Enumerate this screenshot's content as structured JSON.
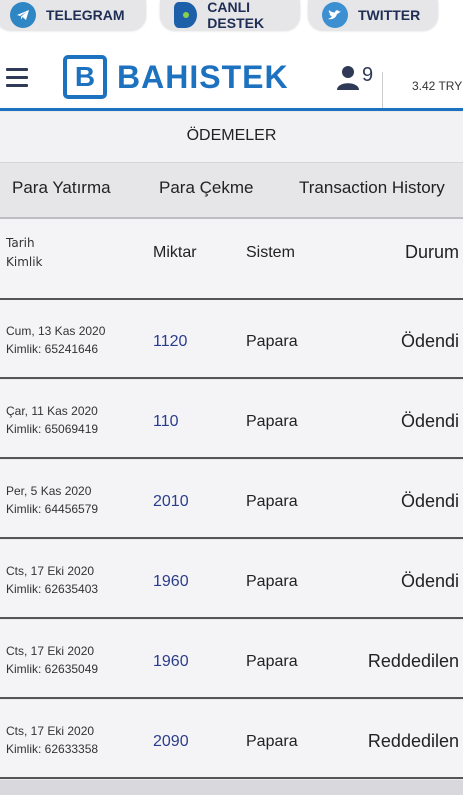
{
  "social": {
    "telegram": "TELEGRAM",
    "live_support": "CANLI DESTEK",
    "twitter": "TWITTER"
  },
  "header": {
    "logo_letter": "B",
    "logo_text": "BAHISTEK",
    "user_count": "9",
    "balance": "3.42 TRY"
  },
  "page_title": "ÖDEMELER",
  "tabs": [
    "Para Yatırma",
    "Para Çekme",
    "Transaction History"
  ],
  "table": {
    "headers": {
      "date": "Tarih",
      "id": "Kimlik",
      "amount": "Miktar",
      "system": "Sistem",
      "status": "Durum"
    },
    "rows": [
      {
        "date": "Cum, 13 Kas 2020",
        "id": "Kimlik: 65241646",
        "amount": "1120",
        "system": "Papara",
        "status": "Ödendi"
      },
      {
        "date": "Çar, 11 Kas 2020",
        "id": "Kimlik: 65069419",
        "amount": "110",
        "system": "Papara",
        "status": "Ödendi"
      },
      {
        "date": "Per, 5 Kas 2020",
        "id": "Kimlik: 64456579",
        "amount": "2010",
        "system": "Papara",
        "status": "Ödendi"
      },
      {
        "date": "Cts, 17 Eki 2020",
        "id": "Kimlik: 62635403",
        "amount": "1960",
        "system": "Papara",
        "status": "Ödendi"
      },
      {
        "date": "Cts, 17 Eki 2020",
        "id": "Kimlik: 62635049",
        "amount": "1960",
        "system": "Papara",
        "status": "Reddedilen"
      },
      {
        "date": "Cts, 17 Eki 2020",
        "id": "Kimlik: 62633358",
        "amount": "2090",
        "system": "Papara",
        "status": "Reddedilen"
      }
    ]
  },
  "colors": {
    "brand": "#1d72c0",
    "amount": "#2a3c8c"
  }
}
